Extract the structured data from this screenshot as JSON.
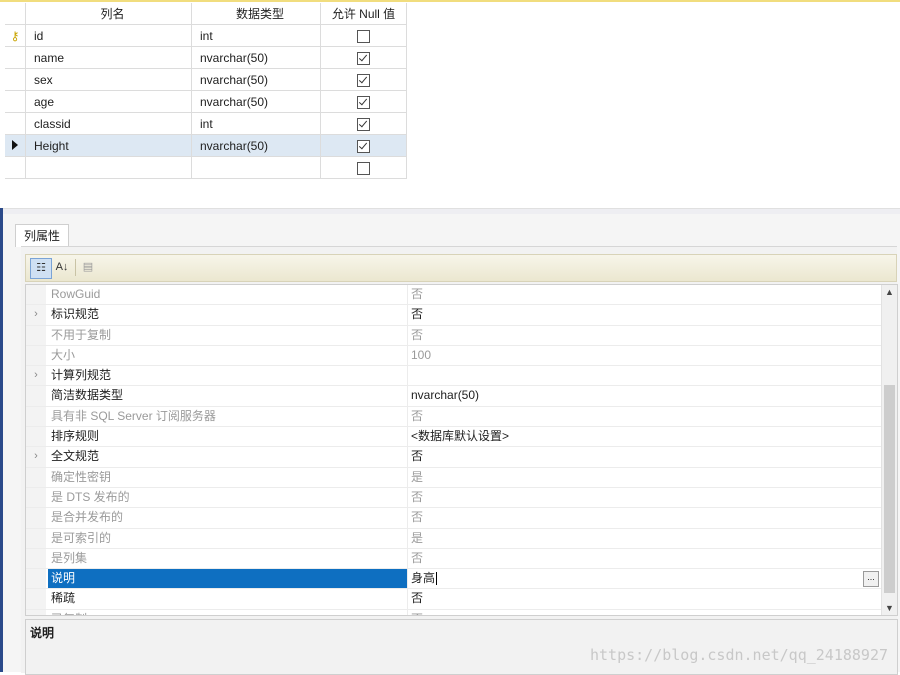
{
  "grid": {
    "headers": {
      "name": "列名",
      "type": "数据类型",
      "null": "允许 Null 值"
    },
    "rows": [
      {
        "name": "id",
        "type": "int",
        "allow_null": false,
        "primary_key": true,
        "current": false
      },
      {
        "name": "name",
        "type": "nvarchar(50)",
        "allow_null": true,
        "primary_key": false,
        "current": false
      },
      {
        "name": "sex",
        "type": "nvarchar(50)",
        "allow_null": true,
        "primary_key": false,
        "current": false
      },
      {
        "name": "age",
        "type": "nvarchar(50)",
        "allow_null": true,
        "primary_key": false,
        "current": false
      },
      {
        "name": "classid",
        "type": "int",
        "allow_null": true,
        "primary_key": false,
        "current": false
      },
      {
        "name": "Height",
        "type": "nvarchar(50)",
        "allow_null": true,
        "primary_key": false,
        "current": true
      },
      {
        "name": "",
        "type": "",
        "allow_null": false,
        "primary_key": false,
        "current": false
      }
    ]
  },
  "properties": {
    "tab_label": "列属性",
    "toolbar": {
      "categorized_icon": "categorized-icon",
      "sort_icon": "sort-az-icon",
      "pages_icon": "property-pages-icon"
    },
    "rows": [
      {
        "name": "RowGuid",
        "value": "否",
        "disabled": true,
        "expandable": false
      },
      {
        "name": "标识规范",
        "value": "否",
        "disabled": false,
        "expandable": true
      },
      {
        "name": "不用于复制",
        "value": "否",
        "disabled": true,
        "expandable": false
      },
      {
        "name": "大小",
        "value": "100",
        "disabled": true,
        "expandable": false
      },
      {
        "name": "计算列规范",
        "value": "",
        "disabled": false,
        "expandable": true
      },
      {
        "name": "简洁数据类型",
        "value": "nvarchar(50)",
        "disabled": false,
        "expandable": false
      },
      {
        "name": "具有非 SQL Server 订阅服务器",
        "value": "否",
        "disabled": true,
        "expandable": false
      },
      {
        "name": "排序规则",
        "value": "<数据库默认设置>",
        "disabled": false,
        "expandable": false
      },
      {
        "name": "全文规范",
        "value": "否",
        "disabled": false,
        "expandable": true
      },
      {
        "name": "确定性密钥",
        "value": "是",
        "disabled": true,
        "expandable": false
      },
      {
        "name": "是 DTS 发布的",
        "value": "否",
        "disabled": true,
        "expandable": false
      },
      {
        "name": "是合并发布的",
        "value": "否",
        "disabled": true,
        "expandable": false
      },
      {
        "name": "是可索引的",
        "value": "是",
        "disabled": true,
        "expandable": false
      },
      {
        "name": "是列集",
        "value": "否",
        "disabled": true,
        "expandable": false
      },
      {
        "name": "说明",
        "value": "身高",
        "disabled": false,
        "expandable": false,
        "selected": true
      },
      {
        "name": "稀疏",
        "value": "否",
        "disabled": false,
        "expandable": false
      },
      {
        "name": "已复制",
        "value": "否",
        "disabled": true,
        "expandable": false
      }
    ],
    "ellipsis_label": "...",
    "description_title": "说明"
  },
  "watermark": "https://blog.csdn.net/qq_24188927",
  "colors": {
    "selected_row": "#0e6fc1",
    "current_grid_row": "#dde8f3",
    "key": "#c9a400"
  }
}
